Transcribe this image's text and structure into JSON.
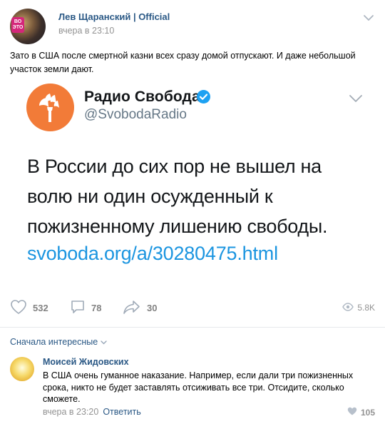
{
  "post": {
    "author": "Лев Щаранский | Official",
    "time": "вчера в 23:10",
    "text": "Зато в США после смертной казни всех сразу домой отпускают. И даже небольшой участок земли дают.",
    "avatar_badge": "ВО ЭТО"
  },
  "tweet": {
    "name": "Радио Свобода",
    "handle": "@SvobodaRadio",
    "body": "В России до сих пор не вышел на волю ни один осужденный к пожизненному лишению свободы.",
    "link": "svoboda.org/a/30280475.html",
    "colors": {
      "logo": "#f27b38",
      "verified": "#1da1f2",
      "link": "#1b95e0"
    }
  },
  "actions": {
    "likes": "532",
    "comments": "78",
    "shares": "30",
    "views": "5.8K"
  },
  "comments_section": {
    "sort_label": "Сначала интересные",
    "items": [
      {
        "author": "Моисей Жидовских",
        "text": "В США очень гуманное наказание. Например, если дали три пожизненных срока, никто не будет заставлять отсиживать все три. Отсидите, сколько сможете.",
        "time": "вчера в 23:20",
        "reply_label": "Ответить",
        "likes": "105"
      }
    ]
  },
  "icons": [
    "chevron-down-icon",
    "verified-icon",
    "heart-icon",
    "comment-icon",
    "share-icon",
    "eye-icon"
  ],
  "accent_color": "#2a5885"
}
